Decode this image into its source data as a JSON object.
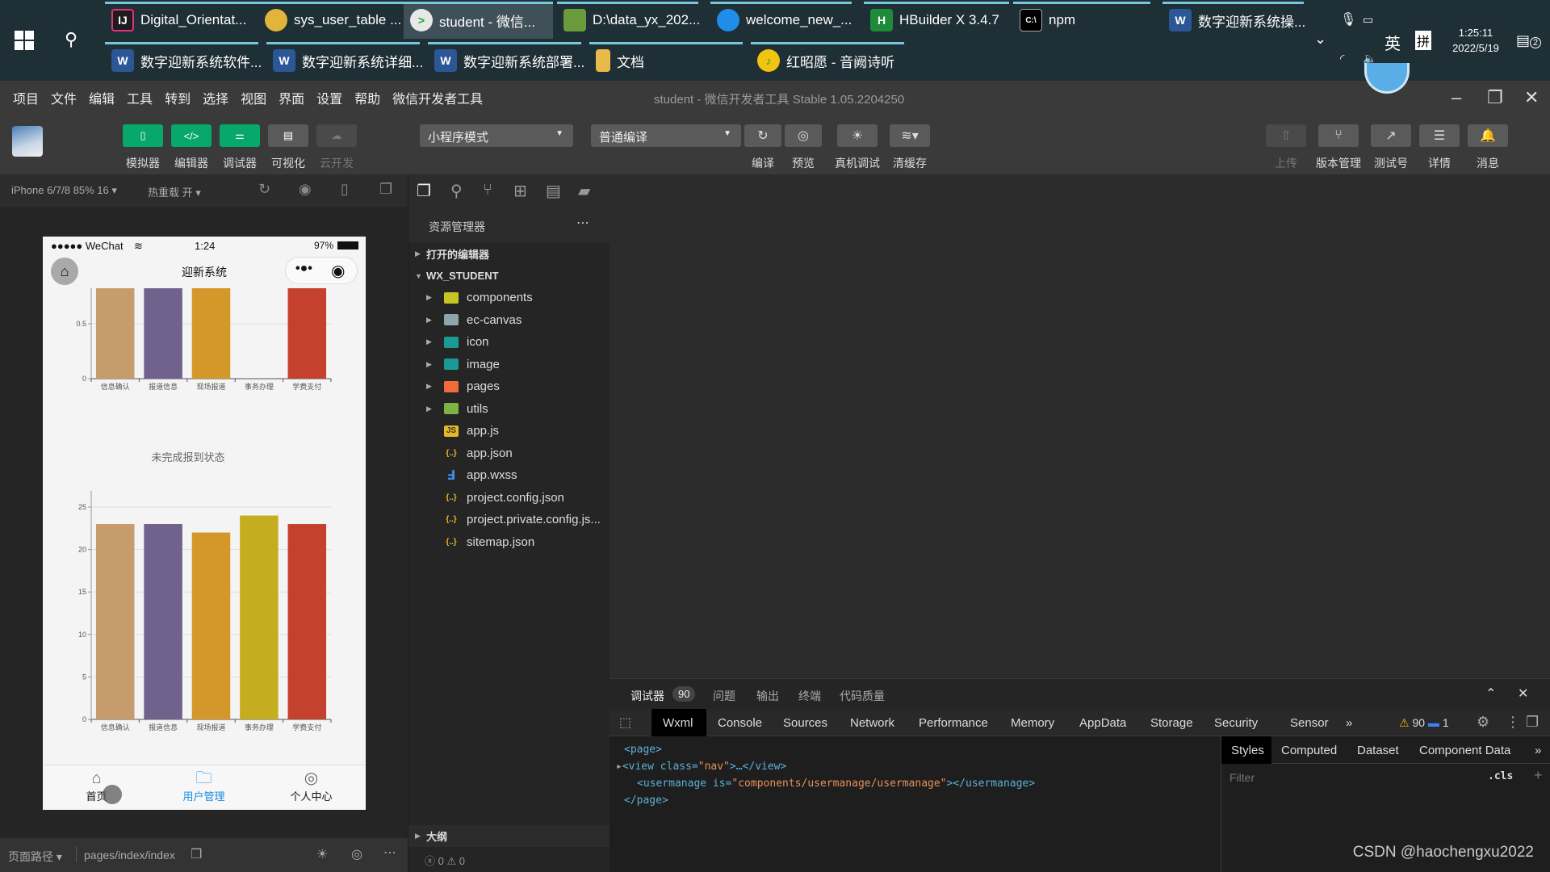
{
  "taskbar": {
    "row1": [
      {
        "label": "Digital_Orientat...",
        "icon": "intellij-icon"
      },
      {
        "label": "sys_user_table ...",
        "icon": "navicat-icon"
      },
      {
        "label": "student - 微信...",
        "icon": "wechat-devtools-icon",
        "active": true
      },
      {
        "label": "D:\\data_yx_202...",
        "icon": "image-viewer-icon"
      },
      {
        "label": "welcome_new_...",
        "icon": "qq-browser-icon"
      },
      {
        "label": "HBuilder X 3.4.7",
        "icon": "hbuilder-icon"
      },
      {
        "label": "npm",
        "icon": "cmd-icon"
      },
      {
        "label": "数字迎新系统操...",
        "icon": "word-icon"
      }
    ],
    "row2": [
      {
        "label": "数字迎新系统软件...",
        "icon": "word-icon"
      },
      {
        "label": "数字迎新系统详细...",
        "icon": "word-icon"
      },
      {
        "label": "数字迎新系统部署...",
        "icon": "word-icon"
      },
      {
        "label": "文档",
        "icon": "folder-icon"
      },
      {
        "label": "红昭愿 - 音阙诗听",
        "icon": "music-icon"
      }
    ],
    "tray": {
      "ime1": "英",
      "ime2": "拼",
      "time": "1:25:11",
      "date": "2022/5/19",
      "notifications": "2"
    }
  },
  "menubar": {
    "items": [
      "项目",
      "文件",
      "编辑",
      "工具",
      "转到",
      "选择",
      "视图",
      "界面",
      "设置",
      "帮助",
      "微信开发者工具"
    ],
    "title": "student - 微信开发者工具 Stable 1.05.2204250"
  },
  "toolbar": {
    "simulator": "模拟器",
    "editor": "编辑器",
    "debugger": "调试器",
    "visual": "可视化",
    "cloud": "云开发",
    "mode_select": "小程序模式",
    "compile_select": "普通编译",
    "compile": "编译",
    "preview": "预览",
    "remote_debug": "真机调试",
    "clear_cache": "清缓存",
    "upload": "上传",
    "version": "版本管理",
    "test_account": "测试号",
    "details": "详情",
    "messages": "消息"
  },
  "simulator": {
    "device": "iPhone 6/7/8 85% 16 ▾",
    "hot_reload": "热重载 开 ▾",
    "phone": {
      "carrier": "●●●●● WeChat",
      "time": "1:24",
      "battery": "97%",
      "nav_title": "迎新系统",
      "tabs": [
        {
          "label": "首页",
          "icon": "home-icon"
        },
        {
          "label": "用户管理",
          "icon": "user-folder-icon",
          "active": true
        },
        {
          "label": "个人中心",
          "icon": "profile-icon"
        }
      ]
    },
    "status": {
      "path_label": "页面路径 ▾",
      "path": "pages/index/index"
    }
  },
  "chart_data": [
    {
      "type": "bar",
      "title": "",
      "categories": [
        "信息确认",
        "报道信息",
        "现场报道",
        "事务办理",
        "学费支付"
      ],
      "values": [
        1,
        1,
        1,
        0,
        1
      ],
      "colors": [
        "#c69c6d",
        "#71618d",
        "#d4982a",
        "#c4ae1f",
        "#c4412e"
      ],
      "yticks": [
        "0",
        "0.5"
      ],
      "ylim": [
        0,
        1
      ],
      "note": "top of chart scrolled out of view"
    },
    {
      "type": "bar",
      "title": "未完成报到状态",
      "categories": [
        "信息确认",
        "报道信息",
        "现场报道",
        "事务办理",
        "学费支付"
      ],
      "values": [
        23,
        23,
        22,
        24,
        23
      ],
      "colors": [
        "#c69c6d",
        "#71618d",
        "#d4982a",
        "#c4ae1f",
        "#c4412e"
      ],
      "yticks": [
        "0",
        "5",
        "10",
        "15",
        "20",
        "25"
      ],
      "ylim": [
        0,
        25
      ]
    }
  ],
  "explorer": {
    "title": "资源管理器",
    "open_editors": "打开的编辑器",
    "project": "WX_STUDENT",
    "files": [
      {
        "name": "components",
        "type": "folder",
        "color": "#c5c525"
      },
      {
        "name": "ec-canvas",
        "type": "folder",
        "color": "#90a4ae"
      },
      {
        "name": "icon",
        "type": "folder",
        "color": "#1a9a94"
      },
      {
        "name": "image",
        "type": "folder",
        "color": "#1a9a94"
      },
      {
        "name": "pages",
        "type": "folder",
        "color": "#f26b3a"
      },
      {
        "name": "utils",
        "type": "folder",
        "color": "#7cb342"
      },
      {
        "name": "app.js",
        "type": "js"
      },
      {
        "name": "app.json",
        "type": "json"
      },
      {
        "name": "app.wxss",
        "type": "css"
      },
      {
        "name": "project.config.json",
        "type": "json"
      },
      {
        "name": "project.private.config.js...",
        "type": "json"
      },
      {
        "name": "sitemap.json",
        "type": "json"
      }
    ],
    "outline": "大纲",
    "errors": "0",
    "warnings": "0"
  },
  "debugger": {
    "tabs": [
      "调试器",
      "问题",
      "输出",
      "终端",
      "代码质量"
    ],
    "badge": "90",
    "devtabs": [
      "Wxml",
      "Console",
      "Sources",
      "Network",
      "Performance",
      "Memory",
      "AppData",
      "Storage",
      "Security",
      "Sensor"
    ],
    "warn_count": "90",
    "info_count": "1",
    "wxml": [
      {
        "text": "<page>"
      },
      {
        "pre": "<view class=",
        "val": "\"nav\"",
        "post": ">…</view>"
      },
      {
        "pre": "<usermanage is=",
        "val": "\"components/usermanage/usermanage\"",
        "post": "></usermanage>"
      },
      {
        "text": "</page>"
      }
    ],
    "style_tabs": [
      "Styles",
      "Computed",
      "Dataset",
      "Component Data"
    ],
    "filter_placeholder": "Filter",
    "cls": ".cls"
  },
  "watermark": "CSDN @haochengxu2022"
}
